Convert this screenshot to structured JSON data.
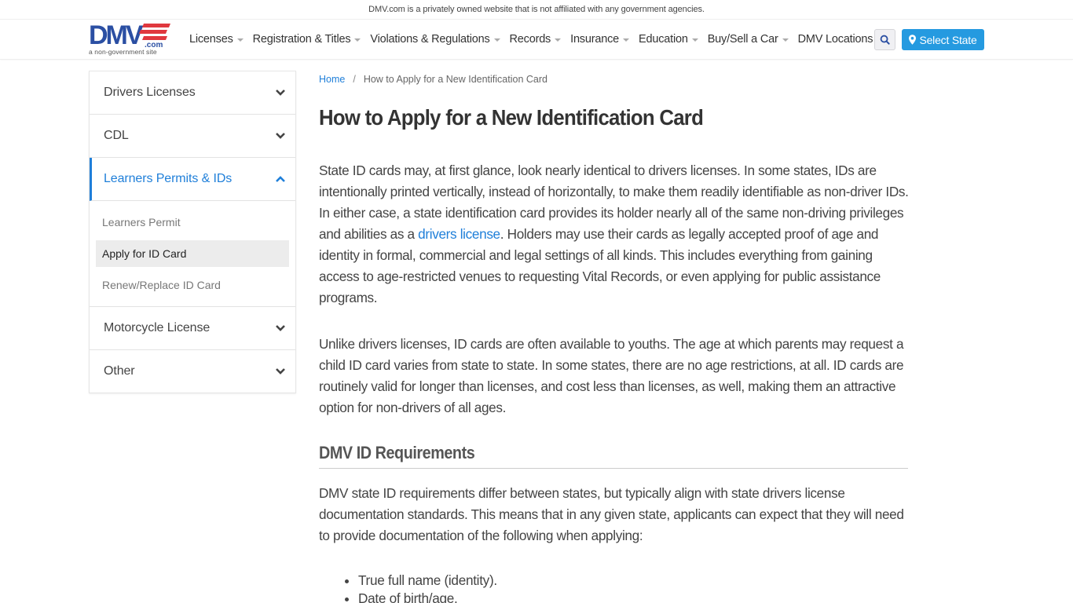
{
  "topbar": {
    "disclaimer": "DMV.com is a privately owned website that is not affiliated with any government agencies."
  },
  "header": {
    "logo_text": "DMV",
    "logo_suffix": ".com",
    "logo_tagline": "a non-government site",
    "nav": [
      {
        "label": "Licenses",
        "dropdown": true
      },
      {
        "label": "Registration & Titles",
        "dropdown": true
      },
      {
        "label": "Violations & Regulations",
        "dropdown": true
      },
      {
        "label": "Records",
        "dropdown": true
      },
      {
        "label": "Insurance",
        "dropdown": true
      },
      {
        "label": "Education",
        "dropdown": true
      },
      {
        "label": "Buy/Sell a Car",
        "dropdown": true
      },
      {
        "label": "DMV Locations",
        "dropdown": false
      }
    ],
    "search_icon": "search-icon",
    "select_state_label": "Select State",
    "select_state_icon": "map-marker-icon"
  },
  "colors": {
    "accent": "#1f7fd9",
    "button_blue": "#259ae0",
    "logo_blue": "#2b4fa3",
    "logo_red": "#e0383e",
    "text": "#444444"
  },
  "sidebar": {
    "sections": [
      {
        "label": "Drivers Licenses",
        "expanded": false
      },
      {
        "label": "CDL",
        "expanded": false
      },
      {
        "label": "Learners Permits & IDs",
        "expanded": true,
        "items": [
          {
            "label": "Learners Permit",
            "current": false
          },
          {
            "label": "Apply for ID Card",
            "current": true
          },
          {
            "label": "Renew/Replace ID Card",
            "current": false
          }
        ]
      },
      {
        "label": "Motorcycle License",
        "expanded": false
      },
      {
        "label": "Other",
        "expanded": false
      }
    ]
  },
  "main": {
    "breadcrumb": {
      "home": "Home",
      "separator": "/",
      "current": "How to Apply for a New Identification Card"
    },
    "title": "How to Apply for a New Identification Card",
    "paragraph1": {
      "before_link": "State ID cards may, at first glance, look nearly identical to drivers licenses. In some states, IDs are intentionally printed vertically, instead of horizontally, to make them readily identifiable as non-driver IDs. In either case, a state identification card provides its holder nearly all of the same non-driving privileges and abilities as a ",
      "link": "drivers license",
      "after_link": ". Holders may use their cards as legally accepted proof of age and identity in formal, commercial and legal settings of all kinds. This includes everything from gaining access to age-restricted venues to requesting Vital Records, or even applying for public assistance programs."
    },
    "paragraph2": "Unlike drivers licenses, ID cards are often available to youths. The age at which parents may request a child ID card varies from state to state. In some states, there are no age restrictions, at all. ID cards are routinely valid for longer than licenses, and cost less than licenses, as well, making them an attractive option for non-drivers of all ages.",
    "section_heading": "DMV ID Requirements",
    "paragraph3": "DMV state ID requirements differ between states, but typically align with state drivers license documentation standards. This means that in any given state, applicants can expect that they will need to provide documentation of the following when applying:",
    "requirements": [
      "True full name (identity).",
      "Date of birth/age."
    ]
  }
}
